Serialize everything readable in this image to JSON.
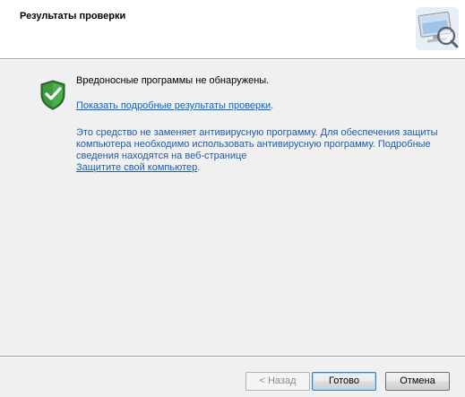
{
  "header": {
    "title": "Результаты проверки",
    "icon": "computer-scan-icon"
  },
  "main": {
    "status_icon": "shield-check-icon",
    "status_message": "Вредоносные программы не обнаружены.",
    "details_link": "Показать подробные результаты проверки",
    "details_suffix": ".",
    "info_text": "Это средство не заменяет антивирусную программу. Для обеспечения защиты компьютера необходимо использовать антивирусную программу. Подробные сведения находятся на веб-странице",
    "info_link": "Защитите свой компьютер",
    "info_suffix": "."
  },
  "footer": {
    "back_label": "< Назад",
    "done_label": "Готово",
    "cancel_label": "Отмена"
  },
  "colors": {
    "link": "#0066cc",
    "info_text": "#1e5ba8",
    "shield_green": "#2e9a2e"
  }
}
